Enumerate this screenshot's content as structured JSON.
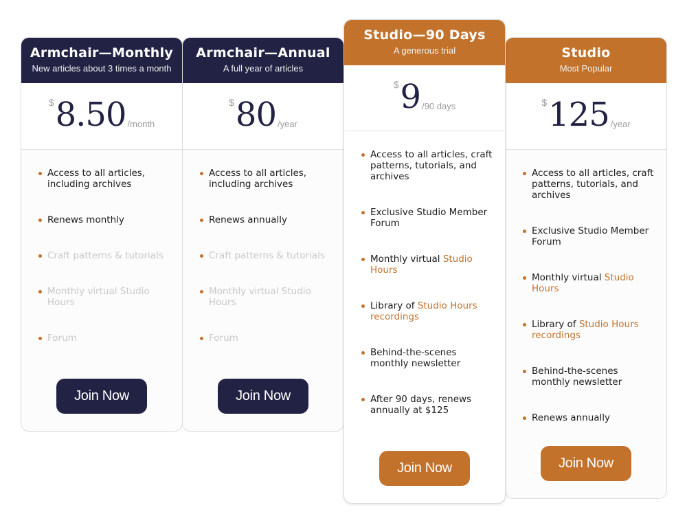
{
  "plans": [
    {
      "title": "Armchair—Monthly",
      "subtitle": "New articles about 3 times a month",
      "currency": "$",
      "amount": "8.50",
      "period": "/month",
      "theme": "navy",
      "features": [
        {
          "segments": [
            {
              "text": "Access to all articles, including archives",
              "highlight": false
            }
          ],
          "disabled": false
        },
        {
          "segments": [
            {
              "text": "Renews monthly",
              "highlight": false
            }
          ],
          "disabled": false
        },
        {
          "segments": [
            {
              "text": "Craft patterns & tutorials",
              "highlight": false
            }
          ],
          "disabled": true
        },
        {
          "segments": [
            {
              "text": "Monthly virtual Studio Hours",
              "highlight": false
            }
          ],
          "disabled": true
        },
        {
          "segments": [
            {
              "text": "Forum",
              "highlight": false
            }
          ],
          "disabled": true
        }
      ],
      "button_label": "Join Now"
    },
    {
      "title": "Armchair—Annual",
      "subtitle": "A full year of articles",
      "currency": "$",
      "amount": "80",
      "period": "/year",
      "theme": "navy",
      "features": [
        {
          "segments": [
            {
              "text": "Access to all articles, including archives",
              "highlight": false
            }
          ],
          "disabled": false
        },
        {
          "segments": [
            {
              "text": "Renews annually",
              "highlight": false
            }
          ],
          "disabled": false
        },
        {
          "segments": [
            {
              "text": "Craft patterns & tutorials",
              "highlight": false
            }
          ],
          "disabled": true
        },
        {
          "segments": [
            {
              "text": "Monthly virtual Studio Hours",
              "highlight": false
            }
          ],
          "disabled": true
        },
        {
          "segments": [
            {
              "text": "Forum",
              "highlight": false
            }
          ],
          "disabled": true
        }
      ],
      "button_label": "Join Now"
    },
    {
      "title": "Studio—90 Days",
      "subtitle": "A generous trial",
      "currency": "$",
      "amount": "9",
      "period": "/90 days",
      "theme": "orange",
      "features": [
        {
          "segments": [
            {
              "text": "Access to all articles, craft patterns, tutorials, and archives",
              "highlight": false
            }
          ],
          "disabled": false
        },
        {
          "segments": [
            {
              "text": "Exclusive Studio Member Forum",
              "highlight": false
            }
          ],
          "disabled": false
        },
        {
          "segments": [
            {
              "text": "Monthly virtual ",
              "highlight": false
            },
            {
              "text": "Studio Hours",
              "highlight": true
            }
          ],
          "disabled": false
        },
        {
          "segments": [
            {
              "text": "Library of ",
              "highlight": false
            },
            {
              "text": "Studio Hours recordings",
              "highlight": true
            }
          ],
          "disabled": false
        },
        {
          "segments": [
            {
              "text": "Behind-the-scenes monthly newsletter",
              "highlight": false
            }
          ],
          "disabled": false
        },
        {
          "segments": [
            {
              "text": "After 90 days, renews annually at $125",
              "highlight": false
            }
          ],
          "disabled": false
        }
      ],
      "button_label": "Join Now"
    },
    {
      "title": "Studio",
      "subtitle": "Most Popular",
      "currency": "$",
      "amount": "125",
      "period": "/year",
      "theme": "orange",
      "features": [
        {
          "segments": [
            {
              "text": "Access to all articles, craft patterns, tutorials, and archives",
              "highlight": false
            }
          ],
          "disabled": false
        },
        {
          "segments": [
            {
              "text": "Exclusive Studio Member Forum",
              "highlight": false
            }
          ],
          "disabled": false
        },
        {
          "segments": [
            {
              "text": "Monthly virtual ",
              "highlight": false
            },
            {
              "text": "Studio Hours",
              "highlight": true
            }
          ],
          "disabled": false
        },
        {
          "segments": [
            {
              "text": "Library of ",
              "highlight": false
            },
            {
              "text": "Studio Hours recordings",
              "highlight": true
            }
          ],
          "disabled": false
        },
        {
          "segments": [
            {
              "text": "Behind-the-scenes monthly newsletter",
              "highlight": false
            }
          ],
          "disabled": false
        },
        {
          "segments": [
            {
              "text": "Renews annually",
              "highlight": false
            }
          ],
          "disabled": false
        }
      ],
      "button_label": "Join Now"
    }
  ],
  "colors": {
    "navy": "#222245",
    "orange": "#c3722b",
    "disabled_text": "#c8c8c8",
    "body_text": "#1c1c1c"
  }
}
